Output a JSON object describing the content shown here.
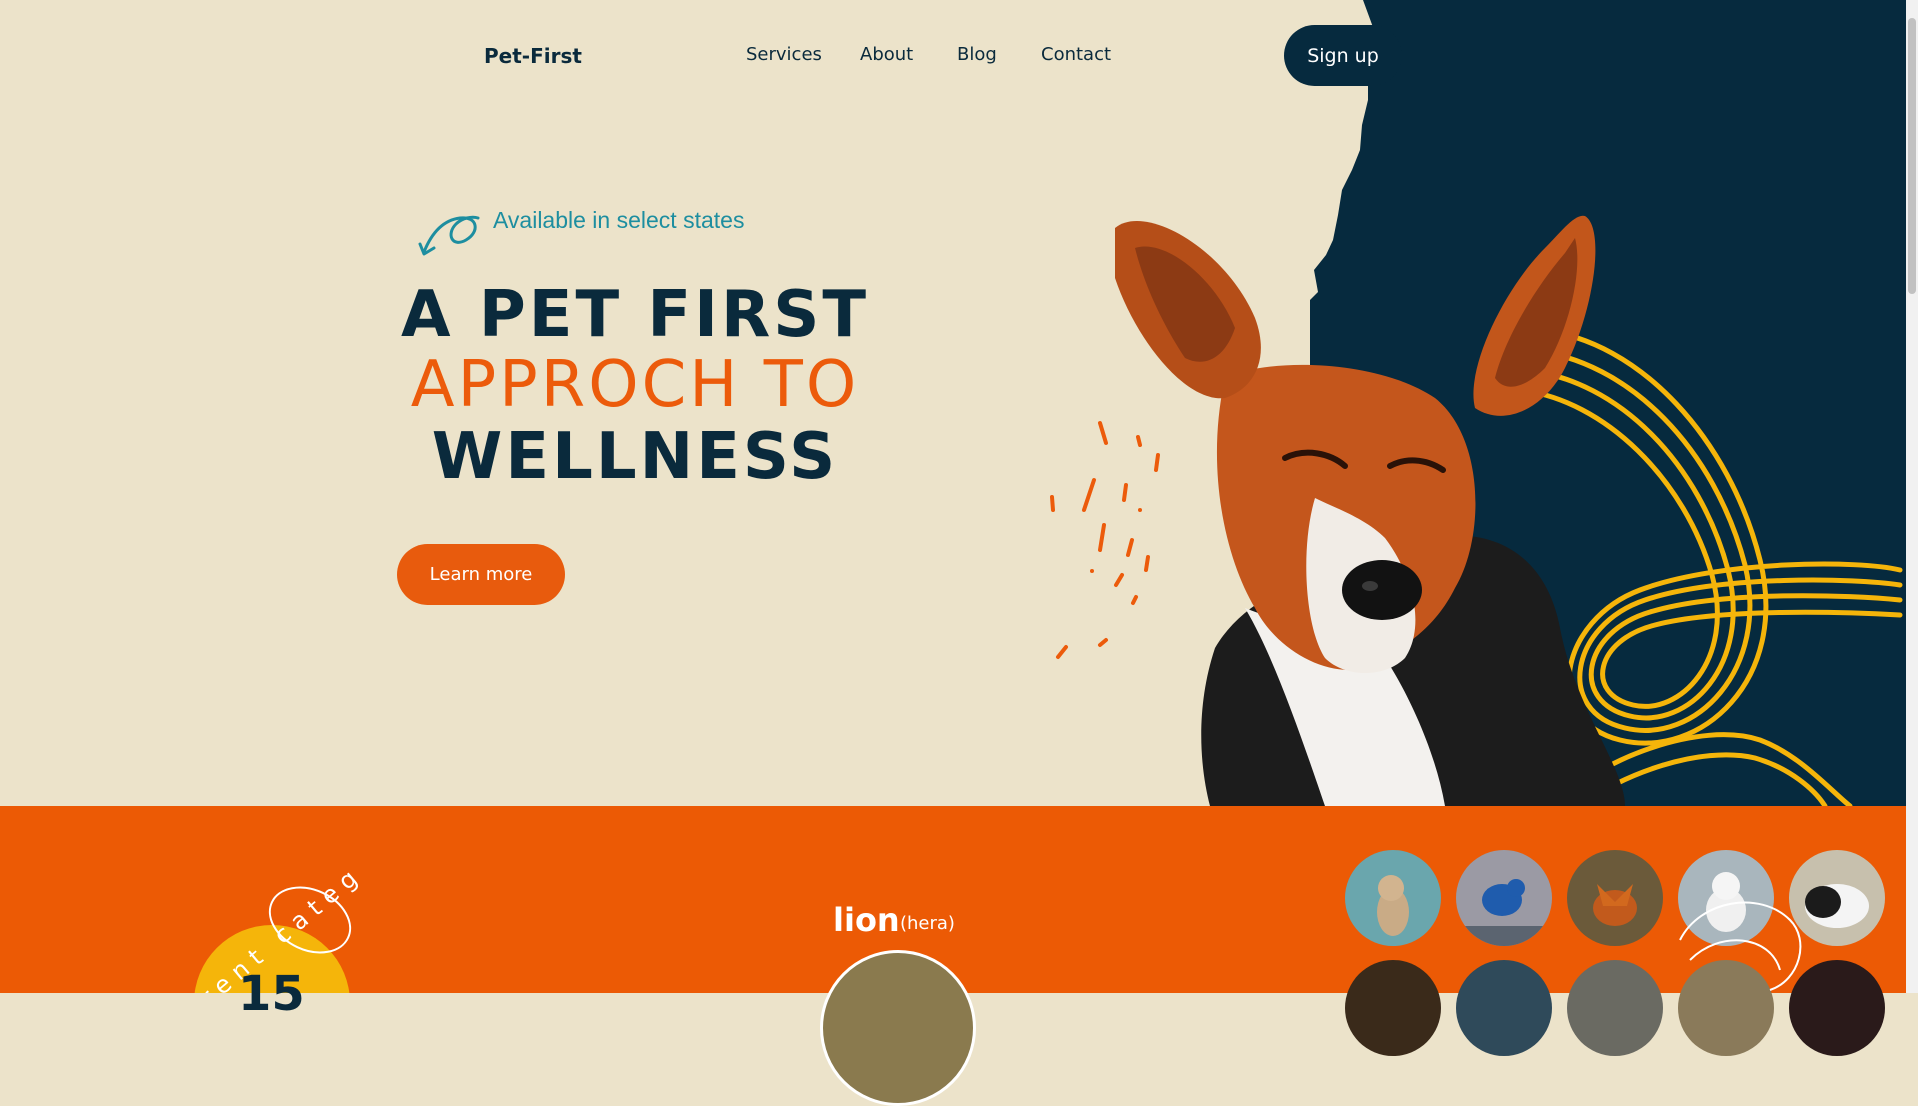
{
  "nav": {
    "brand": "Pet-First",
    "links": [
      "Services",
      "About",
      "Blog",
      "Contact"
    ],
    "signup_label": "Sign up"
  },
  "hero": {
    "tagline": "Available in select states",
    "line1": "A PET FIRST",
    "line2": "APPROCH TO",
    "line3": "WELLNESS",
    "learn_label": "Learn more"
  },
  "categories": {
    "badge_number": "15",
    "badge_ring_text": "erent categ",
    "featured_name": "lion",
    "featured_sub": "(hera)"
  },
  "pets": [
    "cat-photo",
    "bird-photo",
    "fox-photo",
    "white-cat-photo",
    "guinea-pig-photo"
  ],
  "colors": {
    "cream": "#ece3ca",
    "navy": "#062a3e",
    "orange": "#ec5a05",
    "teal": "#1d8ea0",
    "yellow": "#f5b50a"
  }
}
